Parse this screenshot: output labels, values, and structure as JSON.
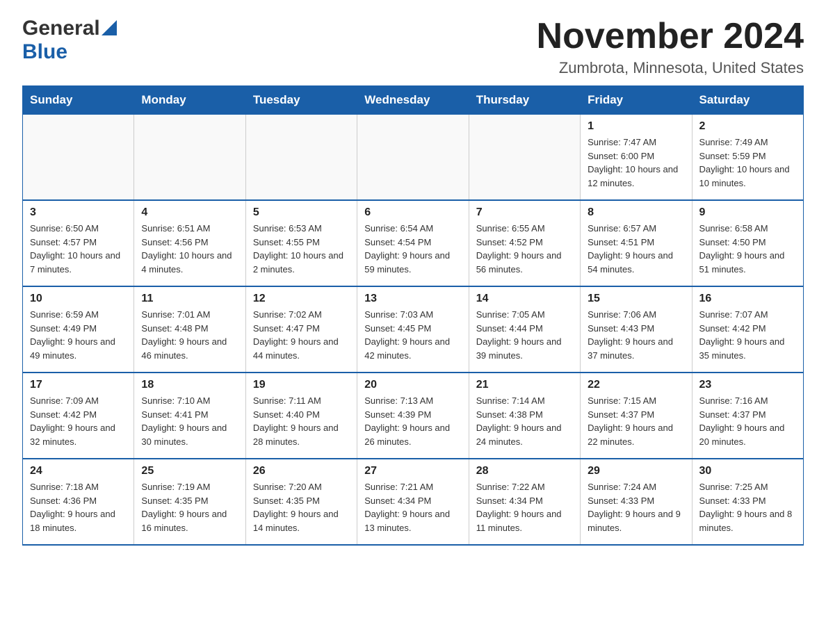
{
  "header": {
    "logo_general": "General",
    "logo_blue": "Blue",
    "title": "November 2024",
    "subtitle": "Zumbrota, Minnesota, United States"
  },
  "calendar": {
    "days_of_week": [
      "Sunday",
      "Monday",
      "Tuesday",
      "Wednesday",
      "Thursday",
      "Friday",
      "Saturday"
    ],
    "weeks": [
      [
        {
          "day": "",
          "info": ""
        },
        {
          "day": "",
          "info": ""
        },
        {
          "day": "",
          "info": ""
        },
        {
          "day": "",
          "info": ""
        },
        {
          "day": "",
          "info": ""
        },
        {
          "day": "1",
          "info": "Sunrise: 7:47 AM\nSunset: 6:00 PM\nDaylight: 10 hours and 12 minutes."
        },
        {
          "day": "2",
          "info": "Sunrise: 7:49 AM\nSunset: 5:59 PM\nDaylight: 10 hours and 10 minutes."
        }
      ],
      [
        {
          "day": "3",
          "info": "Sunrise: 6:50 AM\nSunset: 4:57 PM\nDaylight: 10 hours and 7 minutes."
        },
        {
          "day": "4",
          "info": "Sunrise: 6:51 AM\nSunset: 4:56 PM\nDaylight: 10 hours and 4 minutes."
        },
        {
          "day": "5",
          "info": "Sunrise: 6:53 AM\nSunset: 4:55 PM\nDaylight: 10 hours and 2 minutes."
        },
        {
          "day": "6",
          "info": "Sunrise: 6:54 AM\nSunset: 4:54 PM\nDaylight: 9 hours and 59 minutes."
        },
        {
          "day": "7",
          "info": "Sunrise: 6:55 AM\nSunset: 4:52 PM\nDaylight: 9 hours and 56 minutes."
        },
        {
          "day": "8",
          "info": "Sunrise: 6:57 AM\nSunset: 4:51 PM\nDaylight: 9 hours and 54 minutes."
        },
        {
          "day": "9",
          "info": "Sunrise: 6:58 AM\nSunset: 4:50 PM\nDaylight: 9 hours and 51 minutes."
        }
      ],
      [
        {
          "day": "10",
          "info": "Sunrise: 6:59 AM\nSunset: 4:49 PM\nDaylight: 9 hours and 49 minutes."
        },
        {
          "day": "11",
          "info": "Sunrise: 7:01 AM\nSunset: 4:48 PM\nDaylight: 9 hours and 46 minutes."
        },
        {
          "day": "12",
          "info": "Sunrise: 7:02 AM\nSunset: 4:47 PM\nDaylight: 9 hours and 44 minutes."
        },
        {
          "day": "13",
          "info": "Sunrise: 7:03 AM\nSunset: 4:45 PM\nDaylight: 9 hours and 42 minutes."
        },
        {
          "day": "14",
          "info": "Sunrise: 7:05 AM\nSunset: 4:44 PM\nDaylight: 9 hours and 39 minutes."
        },
        {
          "day": "15",
          "info": "Sunrise: 7:06 AM\nSunset: 4:43 PM\nDaylight: 9 hours and 37 minutes."
        },
        {
          "day": "16",
          "info": "Sunrise: 7:07 AM\nSunset: 4:42 PM\nDaylight: 9 hours and 35 minutes."
        }
      ],
      [
        {
          "day": "17",
          "info": "Sunrise: 7:09 AM\nSunset: 4:42 PM\nDaylight: 9 hours and 32 minutes."
        },
        {
          "day": "18",
          "info": "Sunrise: 7:10 AM\nSunset: 4:41 PM\nDaylight: 9 hours and 30 minutes."
        },
        {
          "day": "19",
          "info": "Sunrise: 7:11 AM\nSunset: 4:40 PM\nDaylight: 9 hours and 28 minutes."
        },
        {
          "day": "20",
          "info": "Sunrise: 7:13 AM\nSunset: 4:39 PM\nDaylight: 9 hours and 26 minutes."
        },
        {
          "day": "21",
          "info": "Sunrise: 7:14 AM\nSunset: 4:38 PM\nDaylight: 9 hours and 24 minutes."
        },
        {
          "day": "22",
          "info": "Sunrise: 7:15 AM\nSunset: 4:37 PM\nDaylight: 9 hours and 22 minutes."
        },
        {
          "day": "23",
          "info": "Sunrise: 7:16 AM\nSunset: 4:37 PM\nDaylight: 9 hours and 20 minutes."
        }
      ],
      [
        {
          "day": "24",
          "info": "Sunrise: 7:18 AM\nSunset: 4:36 PM\nDaylight: 9 hours and 18 minutes."
        },
        {
          "day": "25",
          "info": "Sunrise: 7:19 AM\nSunset: 4:35 PM\nDaylight: 9 hours and 16 minutes."
        },
        {
          "day": "26",
          "info": "Sunrise: 7:20 AM\nSunset: 4:35 PM\nDaylight: 9 hours and 14 minutes."
        },
        {
          "day": "27",
          "info": "Sunrise: 7:21 AM\nSunset: 4:34 PM\nDaylight: 9 hours and 13 minutes."
        },
        {
          "day": "28",
          "info": "Sunrise: 7:22 AM\nSunset: 4:34 PM\nDaylight: 9 hours and 11 minutes."
        },
        {
          "day": "29",
          "info": "Sunrise: 7:24 AM\nSunset: 4:33 PM\nDaylight: 9 hours and 9 minutes."
        },
        {
          "day": "30",
          "info": "Sunrise: 7:25 AM\nSunset: 4:33 PM\nDaylight: 9 hours and 8 minutes."
        }
      ]
    ]
  }
}
